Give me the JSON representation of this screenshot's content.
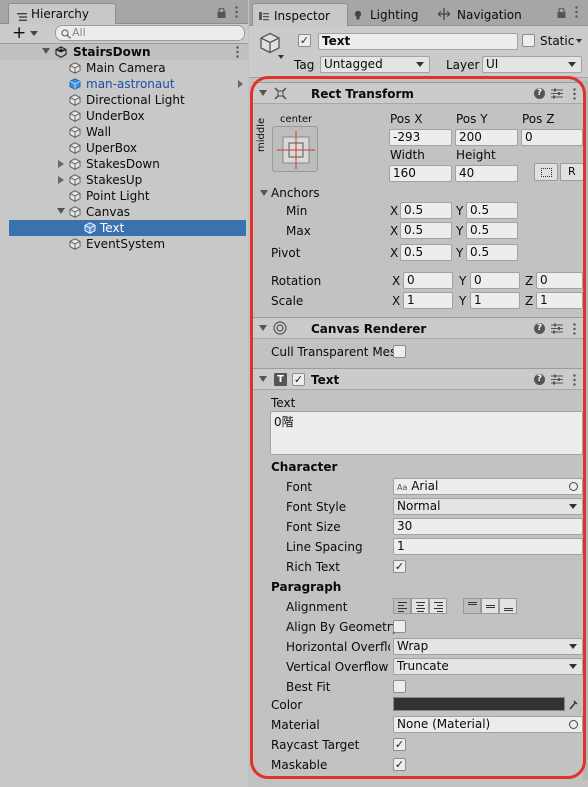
{
  "hierarchy": {
    "tab_label": "Hierarchy",
    "search_placeholder": "All",
    "add_label": "+",
    "scene": "StairsDown",
    "items": [
      {
        "label": "Main Camera"
      },
      {
        "label": "man-astronaut",
        "prefab": true
      },
      {
        "label": "Directional Light"
      },
      {
        "label": "UnderBox"
      },
      {
        "label": "Wall"
      },
      {
        "label": "UperBox"
      },
      {
        "label": "StakesDown"
      },
      {
        "label": "StakesUp"
      },
      {
        "label": "Point Light"
      },
      {
        "label": "Canvas"
      },
      {
        "label": "Text",
        "selected": true
      },
      {
        "label": "EventSystem"
      }
    ]
  },
  "tabs": {
    "inspector": "Inspector",
    "lighting": "Lighting",
    "navigation": "Navigation"
  },
  "object": {
    "name": "Text",
    "static_label": "Static",
    "tag_label": "Tag",
    "tag_value": "Untagged",
    "layer_label": "Layer",
    "layer_value": "UI"
  },
  "rect_transform": {
    "title": "Rect Transform",
    "anchor_h": "center",
    "anchor_v": "middle",
    "pos_x_label": "Pos X",
    "pos_y_label": "Pos Y",
    "pos_z_label": "Pos Z",
    "pos_x": "-293",
    "pos_y": "200",
    "pos_z": "0",
    "width_label": "Width",
    "height_label": "Height",
    "width": "160",
    "height": "40",
    "r_button": "R",
    "anchors_label": "Anchors",
    "min_label": "Min",
    "max_label": "Max",
    "min_x": "0.5",
    "min_y": "0.5",
    "max_x": "0.5",
    "max_y": "0.5",
    "pivot_label": "Pivot",
    "pivot_x": "0.5",
    "pivot_y": "0.5",
    "rotation_label": "Rotation",
    "rot_x": "0",
    "rot_y": "0",
    "rot_z": "0",
    "scale_label": "Scale",
    "scale_x": "1",
    "scale_y": "1",
    "scale_z": "1",
    "x": "X",
    "y": "Y",
    "z": "Z"
  },
  "canvas_renderer": {
    "title": "Canvas Renderer",
    "cull_label": "Cull Transparent Mes"
  },
  "text_component": {
    "title": "Text",
    "text_label": "Text",
    "text_value": "0階",
    "character_label": "Character",
    "font_label": "Font",
    "font_value": "Arial",
    "font_prefix": "Aa",
    "font_style_label": "Font Style",
    "font_style_value": "Normal",
    "font_size_label": "Font Size",
    "font_size_value": "30",
    "line_spacing_label": "Line Spacing",
    "line_spacing_value": "1",
    "rich_text_label": "Rich Text",
    "rich_text": true,
    "paragraph_label": "Paragraph",
    "alignment_label": "Alignment",
    "align_by_geometry_label": "Align By Geometry",
    "align_by_geometry": false,
    "h_overflow_label": "Horizontal Overflo",
    "h_overflow_value": "Wrap",
    "v_overflow_label": "Vertical Overflow",
    "v_overflow_value": "Truncate",
    "best_fit_label": "Best Fit",
    "best_fit": false,
    "color_label": "Color",
    "color_value": "#323232",
    "material_label": "Material",
    "material_value": "None (Material)",
    "raycast_label": "Raycast Target",
    "raycast": true,
    "maskable_label": "Maskable",
    "maskable": true
  },
  "colors": {
    "selection": "#3a72b0",
    "highlight_frame": "#e0332b",
    "prefab_text": "#1a4fa8"
  }
}
